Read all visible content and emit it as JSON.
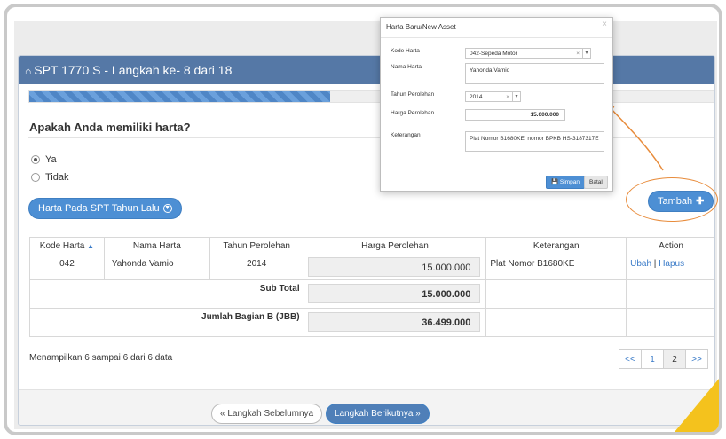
{
  "panel": {
    "title": "SPT 1770 S - Langkah ke- 8 dari 18",
    "progress_fraction": 0.44
  },
  "question": {
    "text": "Apakah Anda memiliki harta?",
    "options": [
      {
        "label": "Ya",
        "selected": true
      },
      {
        "label": "Tidak",
        "selected": false
      }
    ]
  },
  "buttons": {
    "harta_lalu": "Harta Pada SPT Tahun Lalu",
    "tambah": "Tambah",
    "prev": "« Langkah Sebelumnya",
    "next": "Langkah Berikutnya »"
  },
  "table": {
    "headers": [
      "Kode Harta",
      "Nama Harta",
      "Tahun Perolehan",
      "Harga Perolehan",
      "Keterangan",
      "Action"
    ],
    "sort_icon": "▲",
    "rows": [
      {
        "kode": "042",
        "nama": "Yahonda Vamio",
        "tahun": "2014",
        "harga": "15.000.000",
        "keterangan": "Plat Nomor B1680KE",
        "ubah": "Ubah",
        "sep": "|",
        "hapus": "Hapus"
      }
    ],
    "subtotal_label": "Sub Total",
    "subtotal_value": "15.000.000",
    "jbb_label": "Jumlah Bagian B (JBB)",
    "jbb_value": "36.499.000"
  },
  "info": "Menampilkan 6 sampai 6 dari 6 data",
  "pager": [
    "<<",
    "1",
    "2",
    ">>"
  ],
  "pager_active": "2",
  "modal": {
    "title": "Harta Baru/New Asset",
    "close": "×",
    "fields": {
      "kode_label": "Kode Harta",
      "kode_value": "042-Sepeda Motor",
      "nama_label": "Nama Harta",
      "nama_value": "Yahonda Vamio",
      "tahun_label": "Tahun Perolehan",
      "tahun_value": "2014",
      "harga_label": "Harga Perolehan",
      "harga_value": "15.000.000",
      "ket_label": "Keterangan",
      "ket_value": "Plat Nomor B1680KE, nomor BPKB HS-3187317E"
    },
    "save": "Simpan",
    "cancel": "Batal"
  },
  "colors": {
    "header": "#5578a6",
    "accent": "#4d8fd4",
    "annotation": "#e88c3c",
    "corner": "#f4c21d"
  }
}
